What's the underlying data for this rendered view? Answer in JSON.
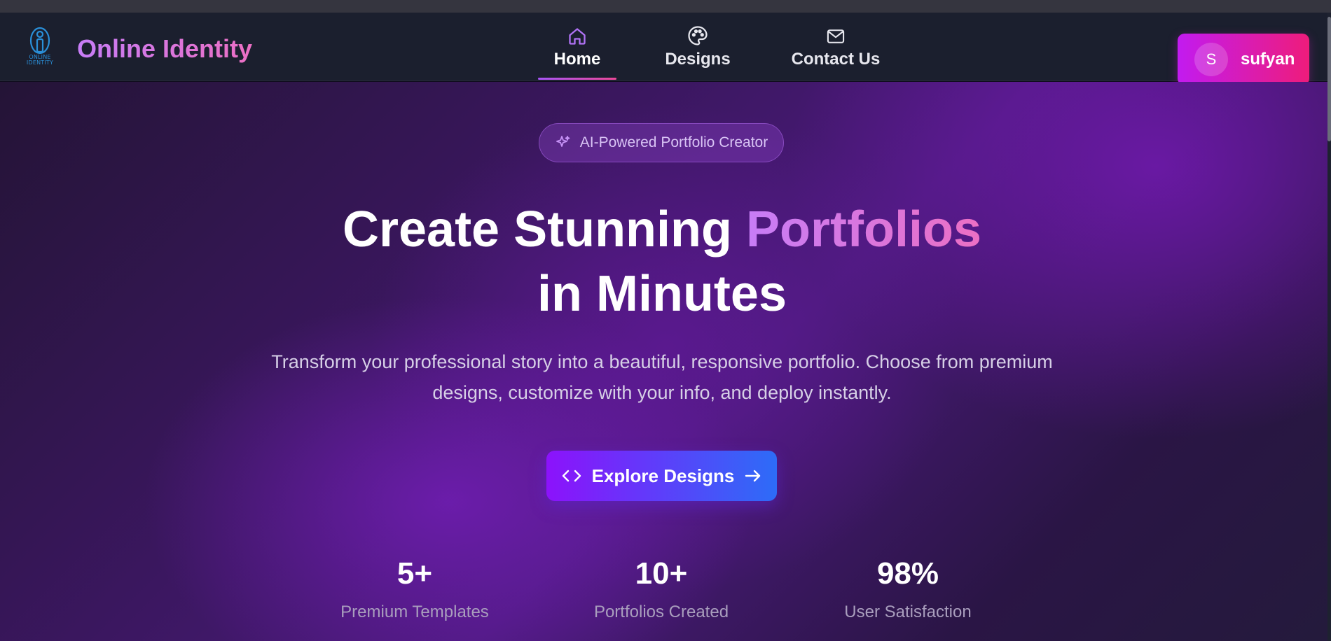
{
  "brand": {
    "name": "Online Identity",
    "logo_text": "ONLINE IDENTITY"
  },
  "nav": {
    "items": [
      {
        "label": "Home",
        "icon": "home-icon",
        "active": true
      },
      {
        "label": "Designs",
        "icon": "palette-icon",
        "active": false
      },
      {
        "label": "Contact Us",
        "icon": "mail-icon",
        "active": false
      }
    ]
  },
  "user": {
    "initial": "S",
    "name": "sufyan"
  },
  "hero": {
    "badge": "AI-Powered Portfolio Creator",
    "headline_part1": "Create Stunning ",
    "headline_accent": "Portfolios",
    "headline_line2": "in Minutes",
    "subtext": "Transform your professional story into a beautiful, responsive portfolio. Choose from premium designs, customize with your info, and deploy instantly.",
    "cta_label": "Explore Designs"
  },
  "stats": [
    {
      "value": "5+",
      "label": "Premium Templates"
    },
    {
      "value": "10+",
      "label": "Portfolios Created"
    },
    {
      "value": "98%",
      "label": "User Satisfaction"
    }
  ],
  "colors": {
    "accent_purple": "#a855f7",
    "accent_pink": "#ec4899",
    "cta_start": "#8c12fb",
    "cta_end": "#2d6cf8",
    "navbar_bg": "#1b1f2e"
  }
}
